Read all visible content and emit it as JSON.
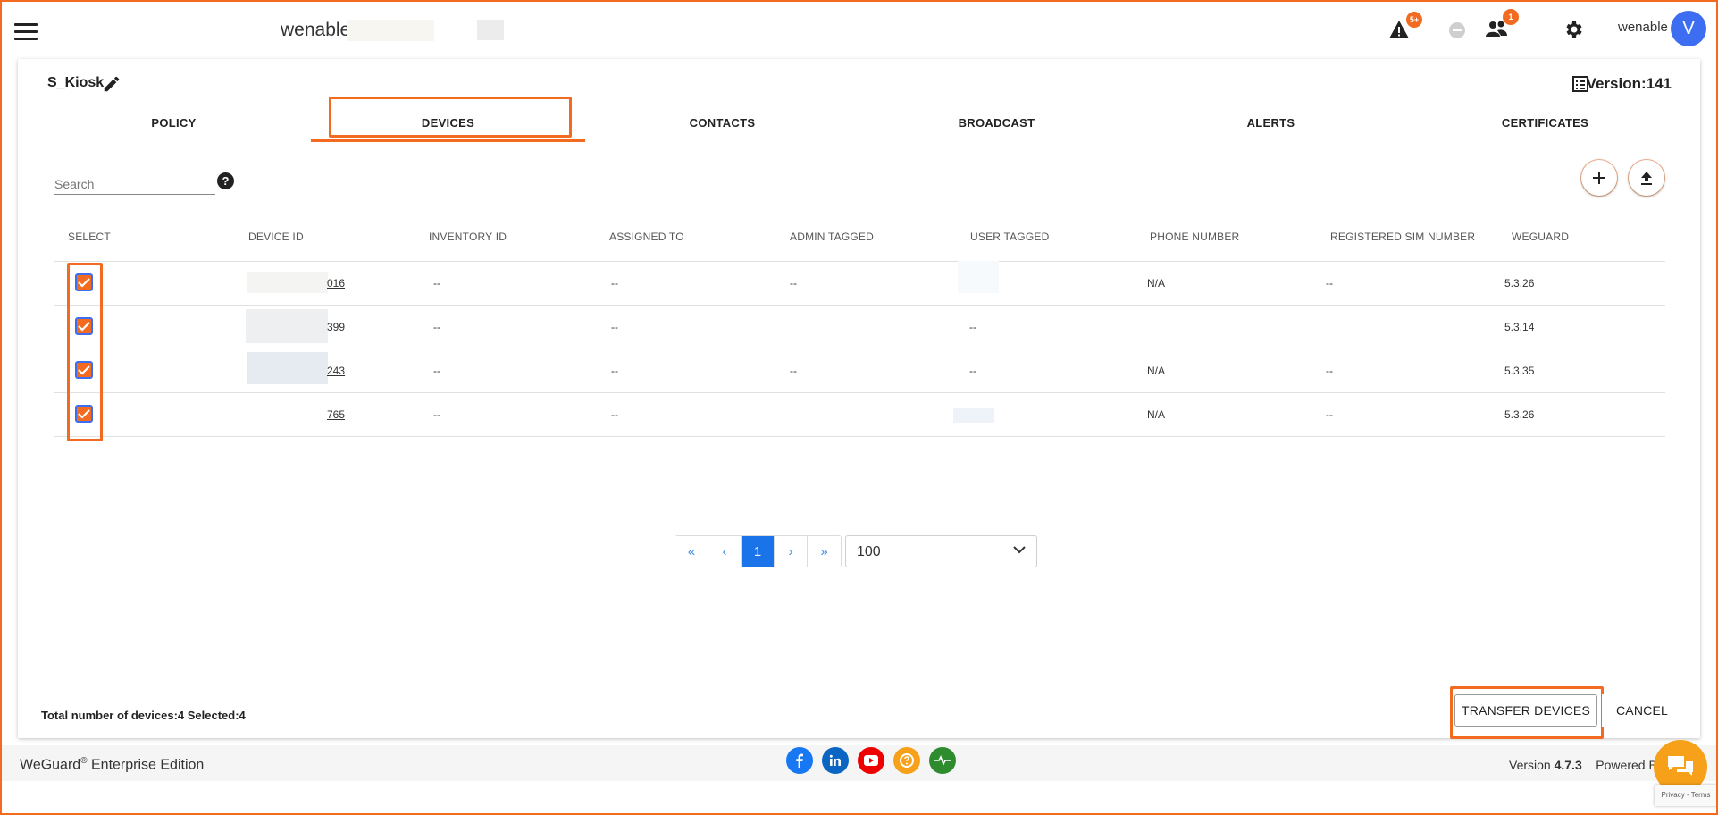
{
  "topbar": {
    "brand": "wenable",
    "alert_badge": "5+",
    "users_badge": "1",
    "user_name": "wenable",
    "avatar_letter": "V"
  },
  "profile": {
    "name": "S_Kiosk",
    "version": "Version:141"
  },
  "tabs": [
    {
      "label": "POLICY"
    },
    {
      "label": "DEVICES"
    },
    {
      "label": "CONTACTS"
    },
    {
      "label": "BROADCAST"
    },
    {
      "label": "ALERTS"
    },
    {
      "label": "CERTIFICATES"
    }
  ],
  "search": {
    "placeholder": "Search"
  },
  "help_glyph": "?",
  "table": {
    "headers": [
      "SELECT",
      "DEVICE ID",
      "INVENTORY ID",
      "ASSIGNED TO",
      "ADMIN TAGGED",
      "USER TAGGED",
      "PHONE NUMBER",
      "REGISTERED SIM NUMBER",
      "WEGUARD"
    ],
    "rows": [
      {
        "device_id": "016",
        "inventory_id": "--",
        "assigned_to": "--",
        "admin_tagged": "--",
        "user_tagged": "",
        "phone": "N/A",
        "sim": "--",
        "weguard": "5.3.26"
      },
      {
        "device_id": "399",
        "inventory_id": "--",
        "assigned_to": "--",
        "admin_tagged": "",
        "user_tagged": "--",
        "phone": "",
        "sim": "",
        "weguard": "5.3.14"
      },
      {
        "device_id": "243",
        "inventory_id": "--",
        "assigned_to": "--",
        "admin_tagged": "--",
        "user_tagged": "--",
        "phone": "N/A",
        "sim": "--",
        "weguard": "5.3.35"
      },
      {
        "device_id": "765",
        "inventory_id": "--",
        "assigned_to": "--",
        "admin_tagged": "",
        "user_tagged": "",
        "phone": "N/A",
        "sim": "--",
        "weguard": "5.3.26"
      }
    ]
  },
  "pagination": {
    "first": "«",
    "prev": "‹",
    "current": "1",
    "next": "›",
    "last": "»",
    "page_size": "100"
  },
  "summary": {
    "text": "Total number of devices:4  Selected:4"
  },
  "actions": {
    "transfer": "TRANSFER DEVICES",
    "cancel": "CANCEL"
  },
  "footer": {
    "edition_brand": "WeGuard",
    "registered": "®",
    "edition_suffix": " Enterprise Edition",
    "version_label": "Version ",
    "version_number": "4.7.3",
    "powered_by": "Powered By",
    "recaptcha": "Privacy - Terms"
  },
  "social_colors": {
    "facebook": "#1877f2",
    "linkedin": "#0a66c2",
    "youtube": "#e00",
    "help": "#f7a11a",
    "status": "#2e8b2e"
  },
  "accent_color": "#f26b21"
}
